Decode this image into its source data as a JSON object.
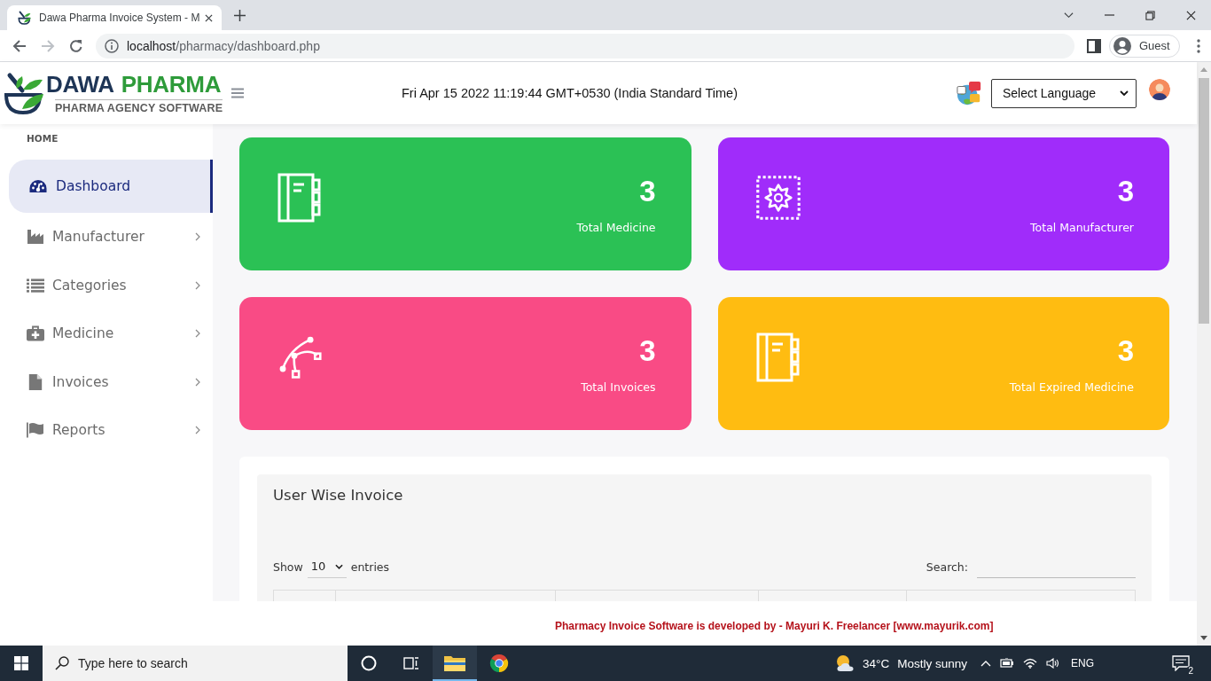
{
  "browser": {
    "tab": {
      "title": "Dawa Pharma Invoice System - M",
      "selected": true
    },
    "address": {
      "host": "localhost",
      "path": "/pharmacy/dashboard.php"
    },
    "profile": {
      "name": "Guest"
    }
  },
  "header": {
    "logo": {
      "name": [
        "DAWA",
        "PHARMA"
      ],
      "tagline": "PHARMA AGENCY SOFTWARE"
    },
    "clock": "Fri Apr 15 2022 11:19:44 GMT+0530 (India Standard Time)",
    "language_select": {
      "value": "Select Language"
    }
  },
  "sidebar": {
    "section": "HOME",
    "items": [
      {
        "label": "Dashboard",
        "selected": true,
        "expandable": false
      },
      {
        "label": "Manufacturer",
        "selected": false,
        "expandable": true
      },
      {
        "label": "Categories",
        "selected": false,
        "expandable": true
      },
      {
        "label": "Medicine",
        "selected": false,
        "expandable": true
      },
      {
        "label": "Invoices",
        "selected": false,
        "expandable": true
      },
      {
        "label": "Reports",
        "selected": false,
        "expandable": true
      }
    ]
  },
  "stats": [
    {
      "count": "3",
      "label": "Total Medicine",
      "color": "#2bc155"
    },
    {
      "count": "3",
      "label": "Total Manufacturer",
      "color": "#a02cfa"
    },
    {
      "count": "3",
      "label": "Total Invoices",
      "color": "#f94b85"
    },
    {
      "count": "3",
      "label": "Total Expired Medicine",
      "color": "#ffbc11"
    }
  ],
  "panel": {
    "title": "User Wise Invoice",
    "length_menu": {
      "label": "Show",
      "value": "10",
      "suffix": "entries"
    },
    "search": {
      "label": "Search:"
    }
  },
  "footer": {
    "credit": "Pharmacy Invoice Software is developed by - Mayuri K. Freelancer [www.mayurik.com]"
  },
  "taskbar": {
    "search": {
      "placeholder": "Type here to search"
    },
    "apps": [
      {
        "running": true
      },
      {
        "running": false
      }
    ],
    "weather": {
      "temperature": "34°C",
      "condition": "Mostly sunny"
    },
    "language": "ENG",
    "notifications": {
      "count": "2"
    }
  }
}
